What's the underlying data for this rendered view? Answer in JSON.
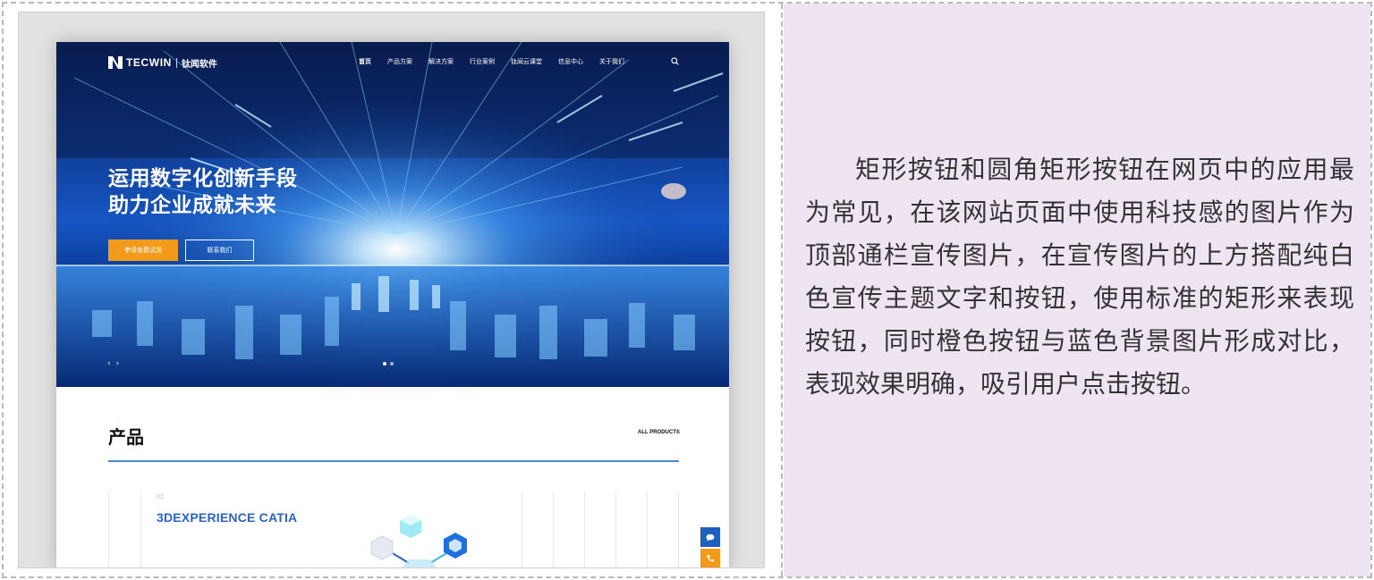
{
  "description": "矩形按钮和圆角矩形按钮在网页中的应用最为常见，在该网站页面中使用科技感的图片作为顶部通栏宣传图片，在宣传图片的上方搭配纯白色宣传主题文字和按钮，使用标准的矩形来表现按钮，同时橙色按钮与蓝色背景图片形成对比，表现效果明确，吸引用户点击按钮。",
  "site": {
    "logo": {
      "brand": "TECWIN",
      "cn": "钛闻软件",
      "icon": "tecwin-logo-icon"
    },
    "nav": [
      {
        "label": "首页",
        "active": true
      },
      {
        "label": "产品方案"
      },
      {
        "label": "解决方案"
      },
      {
        "label": "行业案例"
      },
      {
        "label": "钛闻云课堂"
      },
      {
        "label": "信息中心"
      },
      {
        "label": "关于我们"
      }
    ],
    "hero": {
      "title_line1": "运用数字化创新手段",
      "title_line2": "助力企业成就未来",
      "primary_button": "申请免费试用",
      "secondary_button": "联系我们",
      "prev": "‹",
      "next": "›"
    },
    "products": {
      "title": "产品",
      "all_link": "ALL PRODUCTS",
      "item_number": "02.",
      "item_name": "3DEXPERIENCE CATIA"
    }
  },
  "colors": {
    "accent_orange": "#f29a1a",
    "accent_blue": "#2a63c7",
    "panel_bg": "#efe4f2"
  }
}
